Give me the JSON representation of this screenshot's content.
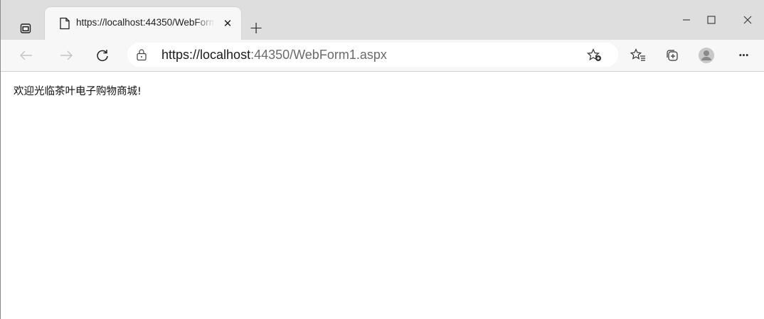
{
  "tab": {
    "title": "https://localhost:44350/WebForm1.aspx",
    "close_glyph": "✕",
    "new_tab_glyph": "+"
  },
  "window_controls": {
    "minimize": "–",
    "maximize": "☐",
    "close": "✕"
  },
  "address": {
    "host": "https://localhost",
    "rest": ":44350/WebForm1.aspx"
  },
  "toolbar": {
    "more_glyph": "···"
  },
  "page": {
    "welcome_text": "欢迎光临茶叶电子购物商城!"
  },
  "colors": {
    "titlebar": "#dedede",
    "toolbar": "#f7f7f7",
    "accent_icon": "#333333"
  }
}
